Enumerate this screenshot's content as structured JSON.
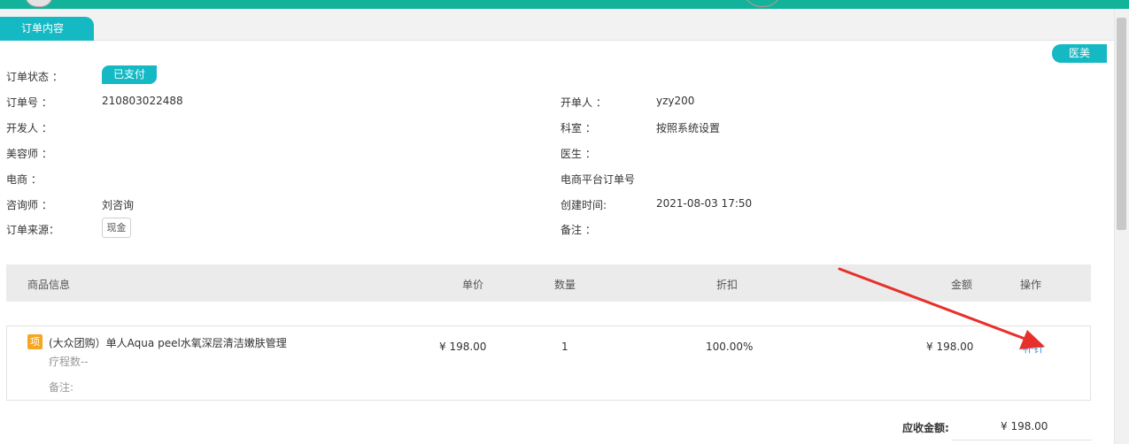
{
  "tab": {
    "label": "订单内容"
  },
  "category_tag": "医美",
  "fields_left": [
    {
      "label": "订单状态 ：",
      "value": ""
    },
    {
      "label": "订单号 ：",
      "value": "210803022488"
    },
    {
      "label": "开发人 ：",
      "value": ""
    },
    {
      "label": "美容师 ：",
      "value": ""
    },
    {
      "label": "电商 ：",
      "value": ""
    },
    {
      "label": "咨询师 ：",
      "value": "刘咨询"
    },
    {
      "label": "订单来源：",
      "value": ""
    }
  ],
  "status_badge": "已支付",
  "source_badge": "现金",
  "fields_right": [
    {
      "label": "开单人 ：",
      "value": "yzy200"
    },
    {
      "label": "科室 ：",
      "value": "按照系统设置"
    },
    {
      "label": "医生 ：",
      "value": ""
    },
    {
      "label": "电商平台订单号",
      "value": ""
    },
    {
      "label": "创建时间:",
      "value": "2021-08-03 17:50"
    },
    {
      "label": "备注 ：",
      "value": ""
    }
  ],
  "table": {
    "headers": {
      "product": "商品信息",
      "price": "单价",
      "qty": "数量",
      "discount": "折扣",
      "amount": "金额",
      "action": "操作"
    },
    "rows": [
      {
        "tag": "项",
        "name": "(大众团购）单人Aqua peel水氧深层清洁嫩肤管理",
        "course": "疗程数--",
        "note": "备注:",
        "price": "¥ 198.00",
        "qty": "1",
        "discount": "100.00%",
        "amount": "¥ 198.00",
        "action": "补针"
      }
    ]
  },
  "total": {
    "label": "应收金额:",
    "value": "¥ 198.00"
  },
  "colors": {
    "accent": "#14b9c4",
    "topbar": "#12b39a",
    "arrow": "#e8302a",
    "item_tag": "#f5a623"
  }
}
